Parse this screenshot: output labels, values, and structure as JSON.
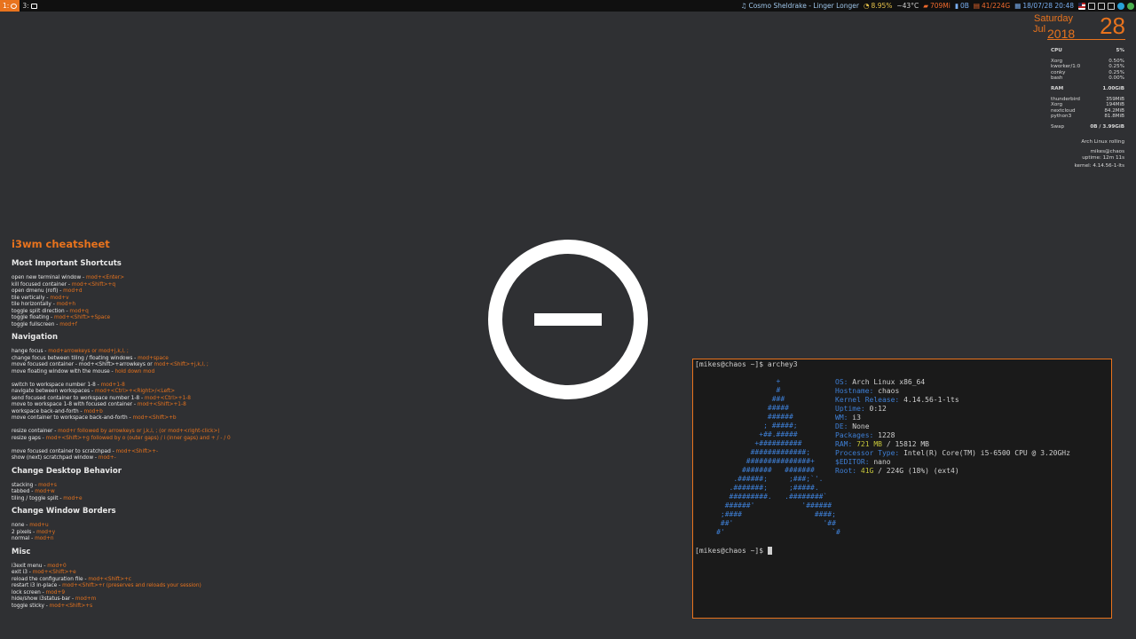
{
  "topbar": {
    "workspaces": [
      {
        "label": "1:",
        "icon": "terminal-icon",
        "active": true
      },
      {
        "label": "3:",
        "icon": "mail-icon",
        "active": false
      }
    ],
    "status": {
      "music": "Cosmo Sheldrake - Linger Longer",
      "load": "8.95%",
      "temp": "~43°C",
      "memory": "709Mi",
      "network": "0B",
      "disk": "41/224G",
      "datetime": "18/07/28 20:48"
    },
    "tray_icons": [
      "flag-icon",
      "window-icon",
      "mail-icon",
      "network-icon",
      "arch-icon",
      "check-icon"
    ]
  },
  "conky": {
    "weekday": "Saturday",
    "month": "Jul",
    "year": "2018",
    "day": "28",
    "cpu": {
      "label": "CPU",
      "value": "5%"
    },
    "cpu_procs": [
      {
        "name": "Xorg",
        "value": "0.50%"
      },
      {
        "name": "kworker/1:0",
        "value": "0.25%"
      },
      {
        "name": "conky",
        "value": "0.25%"
      },
      {
        "name": "bash",
        "value": "0.00%"
      }
    ],
    "ram": {
      "label": "RAM",
      "value": "1.00GiB"
    },
    "ram_procs": [
      {
        "name": "thunderbird",
        "value": "359MiB"
      },
      {
        "name": "Xorg",
        "value": "194MiB"
      },
      {
        "name": "nextcloud",
        "value": "84.2MiB"
      },
      {
        "name": "python3",
        "value": "81.8MiB"
      }
    ],
    "swap": {
      "label": "Swap",
      "value": "0B  / 3.99GiB"
    },
    "distro": "Arch Linux rolling",
    "user": "mikes@chaos",
    "uptime": "uptime: 12m 11s",
    "kernel": "kernel: 4.14.56-1-lts"
  },
  "cheatsheet": {
    "title": "i3wm cheatsheet",
    "sections": [
      {
        "heading": "Most Important Shortcuts",
        "items": [
          {
            "text": "open new terminal window - ",
            "key": "mod+<Enter>"
          },
          {
            "text": "kill focused container - ",
            "key": "mod+<Shift>+q"
          },
          {
            "text": "open dmenu (rofi) - ",
            "key": "mod+d"
          },
          {
            "text": "tile vertically - ",
            "key": "mod+v"
          },
          {
            "text": "tile horizontally - ",
            "key": "mod+h"
          },
          {
            "text": "toggle split direction - ",
            "key": "mod+q"
          },
          {
            "text": "toggle floating - ",
            "key": "mod+<Shift>+Space"
          },
          {
            "text": "toggle fullscreen - ",
            "key": "mod+f"
          }
        ]
      },
      {
        "heading": "Navigation",
        "items": [
          {
            "text": "hange focus - ",
            "key": "mod+arrowkeys or mod+j,k,l, ;"
          },
          {
            "text": "change focus between tiling / floating windows - ",
            "key": "mod+space"
          },
          {
            "text": "move focused container - mod+<Shift>+arrowkeys or ",
            "key": "mod+<Shift>+j,k,l, ;"
          },
          {
            "text": "move floating window with the mouse - ",
            "key": "hold down mod"
          },
          {
            "text": "",
            "key": ""
          },
          {
            "text": "switch to workspace number 1-8 - ",
            "key": "mod+1-8"
          },
          {
            "text": "navigate between workspaces - ",
            "key": "mod+<Ctrl>+<Right>/<Left>"
          },
          {
            "text": "send focused container to workspace number 1-8 - ",
            "key": "mod+<Ctrl>+1-8"
          },
          {
            "text": "move to workspace 1-8 with focused container - ",
            "key": "mod+<Shift>+1-8"
          },
          {
            "text": "workspace back-and-forth - ",
            "key": "mod+b"
          },
          {
            "text": "move container to workspace back-and-forth - ",
            "key": "mod+<Shift>+b"
          },
          {
            "text": "",
            "key": ""
          },
          {
            "text": "resize container - ",
            "key": "mod+r followed by arrowkeys or j,k,l, ;  (or mod+<right-click>)"
          },
          {
            "text": "resize gaps - ",
            "key": "mod+<Shift>+g followed by o (outer gaps) / i (inner gaps) and + / - / 0"
          },
          {
            "text": "",
            "key": ""
          },
          {
            "text": "move focused container to scratchpad - ",
            "key": "mod+<Shift>+-"
          },
          {
            "text": "show (next) scratchpad window - ",
            "key": "mod+-"
          }
        ]
      },
      {
        "heading": "Change Desktop Behavior",
        "items": [
          {
            "text": "stacking - ",
            "key": "mod+s"
          },
          {
            "text": "tabbed - ",
            "key": "mod+w"
          },
          {
            "text": "tiling / toggle split - ",
            "key": "mod+e"
          }
        ]
      },
      {
        "heading": "Change Window Borders",
        "items": [
          {
            "text": "none - ",
            "key": "mod+u"
          },
          {
            "text": "2 pixels - ",
            "key": "mod+y"
          },
          {
            "text": "normal - ",
            "key": "mod+n"
          }
        ]
      },
      {
        "heading": "Misc",
        "items": [
          {
            "text": "i3exit menu - ",
            "key": "mod+0"
          },
          {
            "text": "exit i3 - ",
            "key": "mod+<Shift>+e"
          },
          {
            "text": "reload the configuration file - ",
            "key": "mod+<Shift>+c"
          },
          {
            "text": "restart i3 in-place - ",
            "key": "mod+<Shift>+r (preserves and reloads your session)"
          },
          {
            "text": "lock screen - ",
            "key": "mod+9"
          },
          {
            "text": "hide/show i3status-bar - ",
            "key": "mod+m"
          },
          {
            "text": "toggle sticky - ",
            "key": "mod+<Shift>+s"
          }
        ]
      }
    ]
  },
  "center_logo": {
    "icon": "circle-minus-icon"
  },
  "terminal": {
    "prompt": "[mikes@chaos ~]$ ",
    "command": "archey3",
    "ascii_art": [
      "                   +",
      "                   #",
      "                  ###",
      "                 #####",
      "                 ######",
      "                ; #####;",
      "               +##.#####",
      "              +##########",
      "             #############;",
      "            ###############+",
      "           #######   #######",
      "         .######;     ;###;`'.",
      "        .#######;     ;#####.",
      "        #########.   .########`",
      "       ######'           '######",
      "      ;####                 ####;",
      "      ##'                     '##",
      "     #'                         `#"
    ],
    "info": [
      {
        "label": "OS: ",
        "value": "Arch Linux x86_64"
      },
      {
        "label": "Hostname: ",
        "value": "chaos"
      },
      {
        "label": "Kernel Release: ",
        "value": "4.14.56-1-lts"
      },
      {
        "label": "Uptime: ",
        "value": "0:12"
      },
      {
        "label": "WM: ",
        "value": "i3"
      },
      {
        "label": "DE: ",
        "value": "None"
      },
      {
        "label": "Packages: ",
        "value": "1228"
      },
      {
        "label": "RAM: ",
        "value": "721 MB",
        "suffix": " / 15812 MB"
      },
      {
        "label": "Processor Type: ",
        "value": "Intel(R) Core(TM) i5-6500 CPU @ 3.20GHz"
      },
      {
        "label": "$EDITOR: ",
        "value": "nano"
      },
      {
        "label": "Root: ",
        "value": "41G",
        "suffix": " / 224G (18%) (ext4)"
      }
    ]
  }
}
